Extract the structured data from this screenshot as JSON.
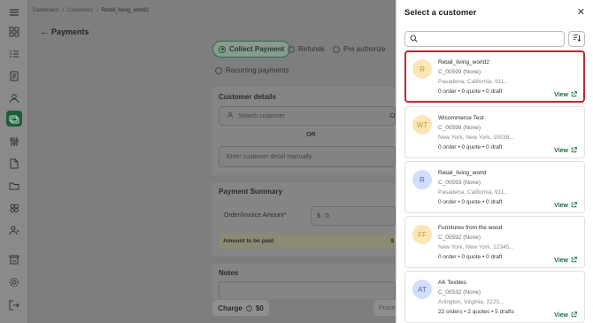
{
  "breadcrumb": {
    "home": "Dashboard",
    "section": "Customers",
    "current": "Retail_living_world2"
  },
  "page": {
    "title": "Payments"
  },
  "payment_options": {
    "collect": "Collect Payment",
    "refunds": "Refunds",
    "preauth": "Pre authorize",
    "recurring": "Recurring payments"
  },
  "customer_details": {
    "title": "Customer details",
    "search_placeholder": "Search customer",
    "or_label": "OR",
    "manual_placeholder": "Enter customer detail manually"
  },
  "payment_summary": {
    "title": "Payment Summary",
    "amount_label": "Order/Invoice Amount*",
    "currency": "$",
    "amount_value": "0",
    "to_pay_label": "Amount to be paid",
    "to_pay_value": "$"
  },
  "notes": {
    "title": "Notes"
  },
  "footer": {
    "charge_label": "Charge",
    "charge_amount": "$0",
    "proceed_label": "Proce"
  },
  "drawer": {
    "title": "Select a customer",
    "search_placeholder": "",
    "view_label": "View",
    "customers": [
      {
        "initials": "R",
        "name": "Retail_living_world2",
        "id": "C_00599 (None)",
        "address": "Pasadena, California, 911...",
        "stats": "0 order • 0 quote • 0 draft",
        "selected": true
      },
      {
        "initials": "WT",
        "name": "Wicommerce Test",
        "id": "C_00598 (None)",
        "address": "New York, New York, 10038...",
        "stats": "0 order • 0 quote • 0 draft",
        "selected": false
      },
      {
        "initials": "R",
        "name": "Retail_living_world",
        "id": "C_00593 (None)",
        "address": "Pasadena, California, 911...",
        "stats": "0 order • 0 quote • 0 draft",
        "selected": false
      },
      {
        "initials": "FF",
        "name": "Furnitures from the wood",
        "id": "C_00592 (None)",
        "address": "New York, New York, 12345...",
        "stats": "0 order • 0 quote • 0 draft",
        "selected": false
      },
      {
        "initials": "AT",
        "name": "AK Textiles",
        "id": "C_00532 (None)",
        "address": "Arlington, Virginia, 2220...",
        "stats": "22 orders • 2 quotes • 5 drafts",
        "selected": false
      }
    ]
  },
  "colors": {
    "brand_green": "#1c5d3a",
    "selected_border": "#c0282d",
    "avatar_yellow": "#fbe7b6",
    "avatar_blue": "#d3defa"
  }
}
